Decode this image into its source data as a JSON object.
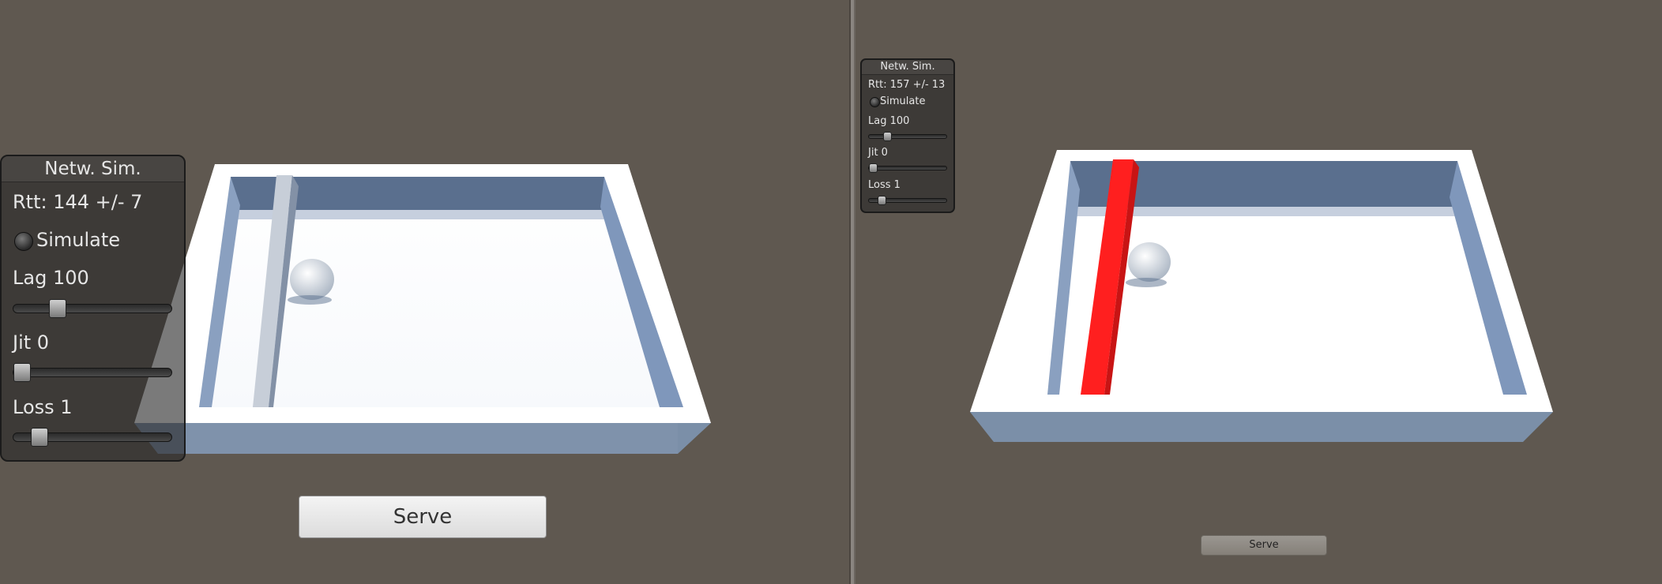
{
  "views": [
    {
      "panel": {
        "title": "Netw. Sim.",
        "rtt": "Rtt: 144 +/-  7",
        "simulate_label": "Simulate",
        "simulate_on": false,
        "lag_label": "Lag 100",
        "lag_value": 0.25,
        "jit_label": "Jit 0",
        "jit_value": 0,
        "loss_label": "Loss 1",
        "loss_value": 0.12
      },
      "serve_label": "Serve",
      "paddle_color": "#e8eef5"
    },
    {
      "panel": {
        "title": "Netw. Sim.",
        "rtt": "Rtt: 157 +/- 13",
        "simulate_label": "Simulate",
        "simulate_on": false,
        "lag_label": "Lag 100",
        "lag_value": 0.2,
        "jit_label": "Jit 0",
        "jit_value": 0,
        "loss_label": "Loss 1",
        "loss_value": 0.12
      },
      "serve_label": "Serve",
      "paddle_color": "#ff1f1f"
    }
  ],
  "colors": {
    "background": "#5f5850",
    "arena_white": "#ffffff",
    "wall_shadow": "#5a7aa8"
  }
}
